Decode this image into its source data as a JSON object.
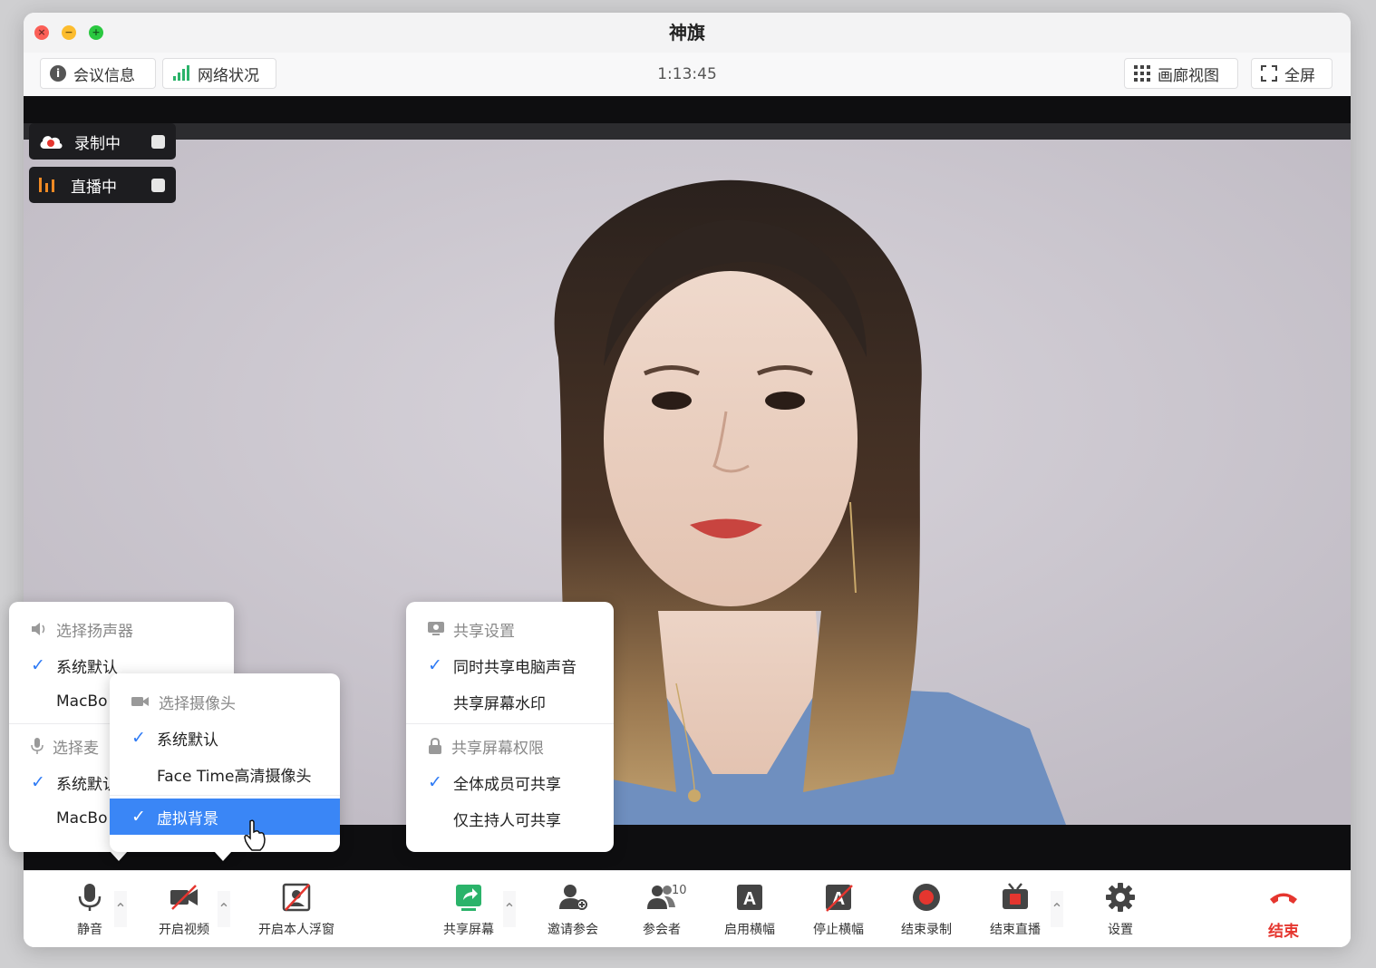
{
  "window": {
    "title": "神旗"
  },
  "topbar": {
    "meeting_info": "会议信息",
    "network_status": "网络状况",
    "timer": "1:13:45",
    "gallery_view": "画廊视图",
    "fullscreen": "全屏"
  },
  "status": {
    "recording": "录制中",
    "live": "直播中"
  },
  "audio_menu": {
    "speaker_header": "选择扬声器",
    "speaker_items": [
      "系统默认",
      "MacBo"
    ],
    "mic_header": "选择麦",
    "mic_items": [
      "系统默认",
      "MacBo"
    ]
  },
  "camera_menu": {
    "header": "选择摄像头",
    "items": [
      "系统默认",
      "Face Time高清摄像头"
    ],
    "virtual_bg": "虚拟背景"
  },
  "share_menu": {
    "settings_header": "共享设置",
    "settings_items": [
      "同时共享电脑声音",
      "共享屏幕水印"
    ],
    "permission_header": "共享屏幕权限",
    "permission_items": [
      "全体成员可共享",
      "仅主持人可共享"
    ]
  },
  "toolbar": {
    "mute": "静音",
    "start_video": "开启视频",
    "self_float": "开启本人浮窗",
    "share_screen": "共享屏幕",
    "invite": "邀请参会",
    "participants": "参会者",
    "participant_count": "10",
    "enable_banner": "启用横幅",
    "stop_banner": "停止横幅",
    "end_recording": "结束录制",
    "end_live": "结束直播",
    "settings": "设置",
    "end": "结束"
  },
  "colors": {
    "accent": "#3a86f6",
    "check": "#2f7bf5",
    "record_red": "#e5362f",
    "share_green": "#2bb36a",
    "live_orange": "#f08a24"
  },
  "icons": {
    "meeting_info": "info-icon",
    "network": "signal-bars-icon",
    "gallery": "grid-icon",
    "fullscreen": "fullscreen-icon",
    "recording": "cloud-icon",
    "live": "live-bars-icon",
    "speaker": "speaker-icon",
    "mic": "mic-icon",
    "camera": "camera-icon",
    "share_settings": "monitor-icon",
    "share_permission": "lock-icon"
  }
}
